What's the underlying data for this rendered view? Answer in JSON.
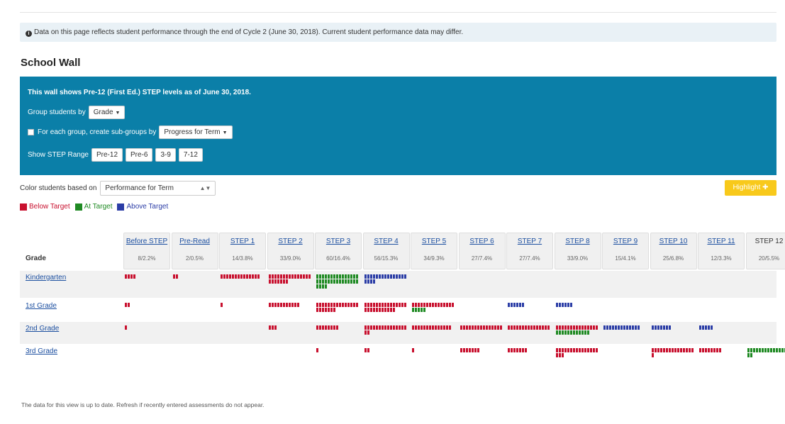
{
  "notice": {
    "icon": "info-icon",
    "text": "Data on this page reflects student performance through the end of Cycle 2 (June 30, 2018). Current student performance data may differ."
  },
  "page_title": "School Wall",
  "panel": {
    "description": "This wall shows Pre-12 (First Ed.) STEP levels as of June 30, 2018.",
    "group_label": "Group students by",
    "group_value": "Grade",
    "subgroup_label": "For each group, create sub-groups by",
    "subgroup_value": "Progress for Term",
    "range_label": "Show STEP Range",
    "ranges": [
      "Pre-12",
      "Pre-6",
      "3-9",
      "7-12"
    ]
  },
  "color_by": {
    "label": "Color students based on",
    "value": "Performance for Term"
  },
  "highlight": {
    "label": "Highlight",
    "icon": "plus-icon"
  },
  "legend": [
    {
      "label": "Below Target",
      "color": "#c8102e"
    },
    {
      "label": "At Target",
      "color": "#1f8a23"
    },
    {
      "label": "Above Target",
      "color": "#2b3da6"
    }
  ],
  "wall": {
    "grade_header": "Grade",
    "levels": [
      {
        "name": "Before STEP",
        "count": "8/2.2%",
        "link": true
      },
      {
        "name": "Pre-Read",
        "count": "2/0.5%",
        "link": true
      },
      {
        "name": "STEP 1",
        "count": "14/3.8%",
        "link": true
      },
      {
        "name": "STEP 2",
        "count": "33/9.0%",
        "link": true
      },
      {
        "name": "STEP 3",
        "count": "60/16.4%",
        "link": true
      },
      {
        "name": "STEP 4",
        "count": "56/15.3%",
        "link": true
      },
      {
        "name": "STEP 5",
        "count": "34/9.3%",
        "link": true
      },
      {
        "name": "STEP 6",
        "count": "27/7.4%",
        "link": true
      },
      {
        "name": "STEP 7",
        "count": "27/7.4%",
        "link": true
      },
      {
        "name": "STEP 8",
        "count": "33/9.0%",
        "link": true
      },
      {
        "name": "STEP 9",
        "count": "15/4.1%",
        "link": true
      },
      {
        "name": "STEP 10",
        "count": "25/6.8%",
        "link": true
      },
      {
        "name": "STEP 11",
        "count": "12/3.3%",
        "link": true
      },
      {
        "name": "STEP 12",
        "count": "20/5.5%",
        "link": false
      }
    ],
    "rows": [
      {
        "grade": "Kindergarten",
        "cells": [
          [
            {
              "s": "below",
              "n": 4
            }
          ],
          [
            {
              "s": "below",
              "n": 2
            }
          ],
          [
            {
              "s": "below",
              "n": 14
            }
          ],
          [
            {
              "s": "below",
              "n": 22
            }
          ],
          [
            {
              "s": "at",
              "n": 34
            }
          ],
          [
            {
              "s": "above",
              "n": 19
            }
          ],
          [],
          [],
          [],
          [],
          [],
          [],
          [],
          []
        ]
      },
      {
        "grade": "1st Grade",
        "cells": [
          [
            {
              "s": "below",
              "n": 2
            }
          ],
          [],
          [
            {
              "s": "below",
              "n": 1
            }
          ],
          [
            {
              "s": "below",
              "n": 11
            }
          ],
          [
            {
              "s": "below",
              "n": 22
            }
          ],
          [
            {
              "s": "below",
              "n": 26
            }
          ],
          [
            {
              "s": "below",
              "n": 15
            },
            {
              "s": "at",
              "n": 5
            }
          ],
          [],
          [
            {
              "s": "above",
              "n": 6
            }
          ],
          [
            {
              "s": "above",
              "n": 6
            }
          ],
          [],
          [],
          [],
          []
        ]
      },
      {
        "grade": "2nd Grade",
        "cells": [
          [
            {
              "s": "below",
              "n": 1
            }
          ],
          [],
          [],
          [
            {
              "s": "below",
              "n": 3
            }
          ],
          [
            {
              "s": "below",
              "n": 8
            }
          ],
          [
            {
              "s": "below",
              "n": 17
            }
          ],
          [
            {
              "s": "below",
              "n": 14
            }
          ],
          [
            {
              "s": "below",
              "n": 15
            }
          ],
          [
            {
              "s": "below",
              "n": 15
            }
          ],
          [
            {
              "s": "below",
              "n": 15
            },
            {
              "s": "at",
              "n": 12
            }
          ],
          [
            {
              "s": "above",
              "n": 13
            }
          ],
          [
            {
              "s": "above",
              "n": 7
            }
          ],
          [
            {
              "s": "above",
              "n": 5
            }
          ],
          []
        ]
      },
      {
        "grade": "3rd Grade",
        "cells": [
          [],
          [],
          [],
          [],
          [
            {
              "s": "below",
              "n": 1
            }
          ],
          [
            {
              "s": "below",
              "n": 2
            }
          ],
          [
            {
              "s": "below",
              "n": 1
            }
          ],
          [
            {
              "s": "below",
              "n": 7
            }
          ],
          [
            {
              "s": "below",
              "n": 7
            }
          ],
          [
            {
              "s": "below",
              "n": 13
            },
            {
              "s": "below",
              "n": 5
            }
          ],
          [],
          [
            {
              "s": "below",
              "n": 16
            }
          ],
          [
            {
              "s": "below",
              "n": 8
            }
          ],
          [
            {
              "s": "at",
              "n": 17
            }
          ]
        ]
      }
    ]
  },
  "footer": "The data for this view is up to date. Refresh if recently entered assessments do not appear."
}
